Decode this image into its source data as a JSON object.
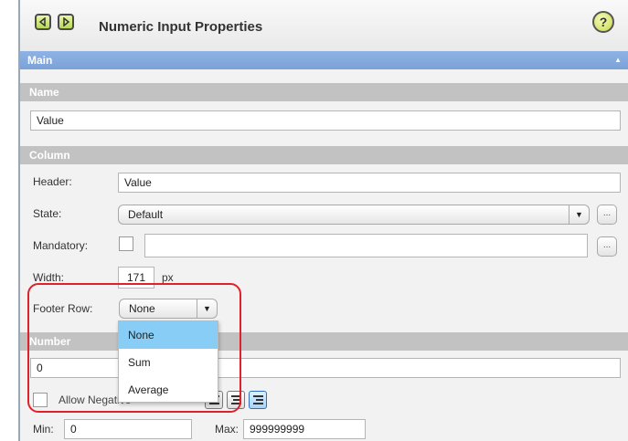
{
  "window": {
    "title": "Numeric Input Properties",
    "help_label": "?"
  },
  "sections": {
    "main": "Main",
    "name": "Name",
    "column": "Column",
    "number": "Number"
  },
  "name": {
    "value": "Value"
  },
  "column": {
    "header_label": "Header:",
    "header_value": "Value",
    "state_label": "State:",
    "state_value": "Default",
    "mandatory_label": "Mandatory:",
    "mandatory_value": "",
    "width_label": "Width:",
    "width_value": "171",
    "width_unit": "px",
    "footer_label": "Footer Row:",
    "footer_value": "None",
    "ellipsis": "..."
  },
  "footer_dropdown": {
    "options": [
      "None",
      "Sum",
      "Average"
    ],
    "selected": "None"
  },
  "number": {
    "value": "0",
    "allow_negative_label": "Allow Negative",
    "min_label": "Min:",
    "min_value": "0",
    "max_label": "Max:",
    "max_value": "999999999"
  },
  "colors": {
    "main_bar": "#7aa2d8",
    "section_bar": "#c2c2c2",
    "highlight": "#e0202a",
    "selected_option": "#87cdf5"
  }
}
